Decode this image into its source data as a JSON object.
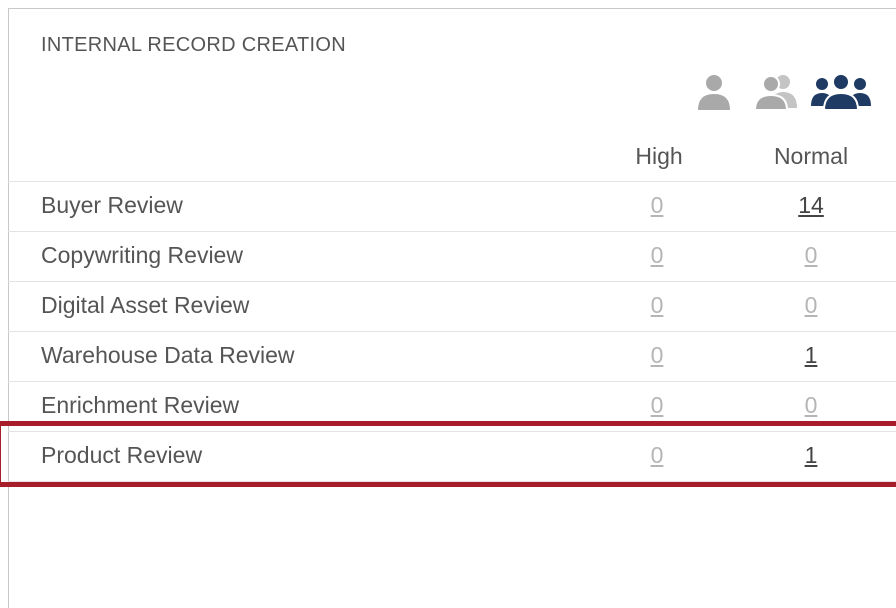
{
  "panel": {
    "title": "INTERNAL RECORD CREATION",
    "icons": [
      {
        "name": "single-user-icon",
        "color": "#a9a9a9"
      },
      {
        "name": "two-users-icon",
        "color": "#a9a9a9"
      },
      {
        "name": "group-users-icon",
        "color": "#1f3a63"
      }
    ],
    "columns": {
      "high": "High",
      "normal": "Normal"
    },
    "rows": [
      {
        "label": "Buyer Review",
        "high": "0",
        "normal": "14"
      },
      {
        "label": "Copywriting Review",
        "high": "0",
        "normal": "0"
      },
      {
        "label": "Digital Asset Review",
        "high": "0",
        "normal": "0"
      },
      {
        "label": "Warehouse Data Review",
        "high": "0",
        "normal": "1"
      },
      {
        "label": "Enrichment Review",
        "high": "0",
        "normal": "0"
      },
      {
        "label": "Product Review",
        "high": "0",
        "normal": "1"
      }
    ],
    "highlighted_row": "Product Review",
    "highlight_color": "#a81d2a"
  }
}
